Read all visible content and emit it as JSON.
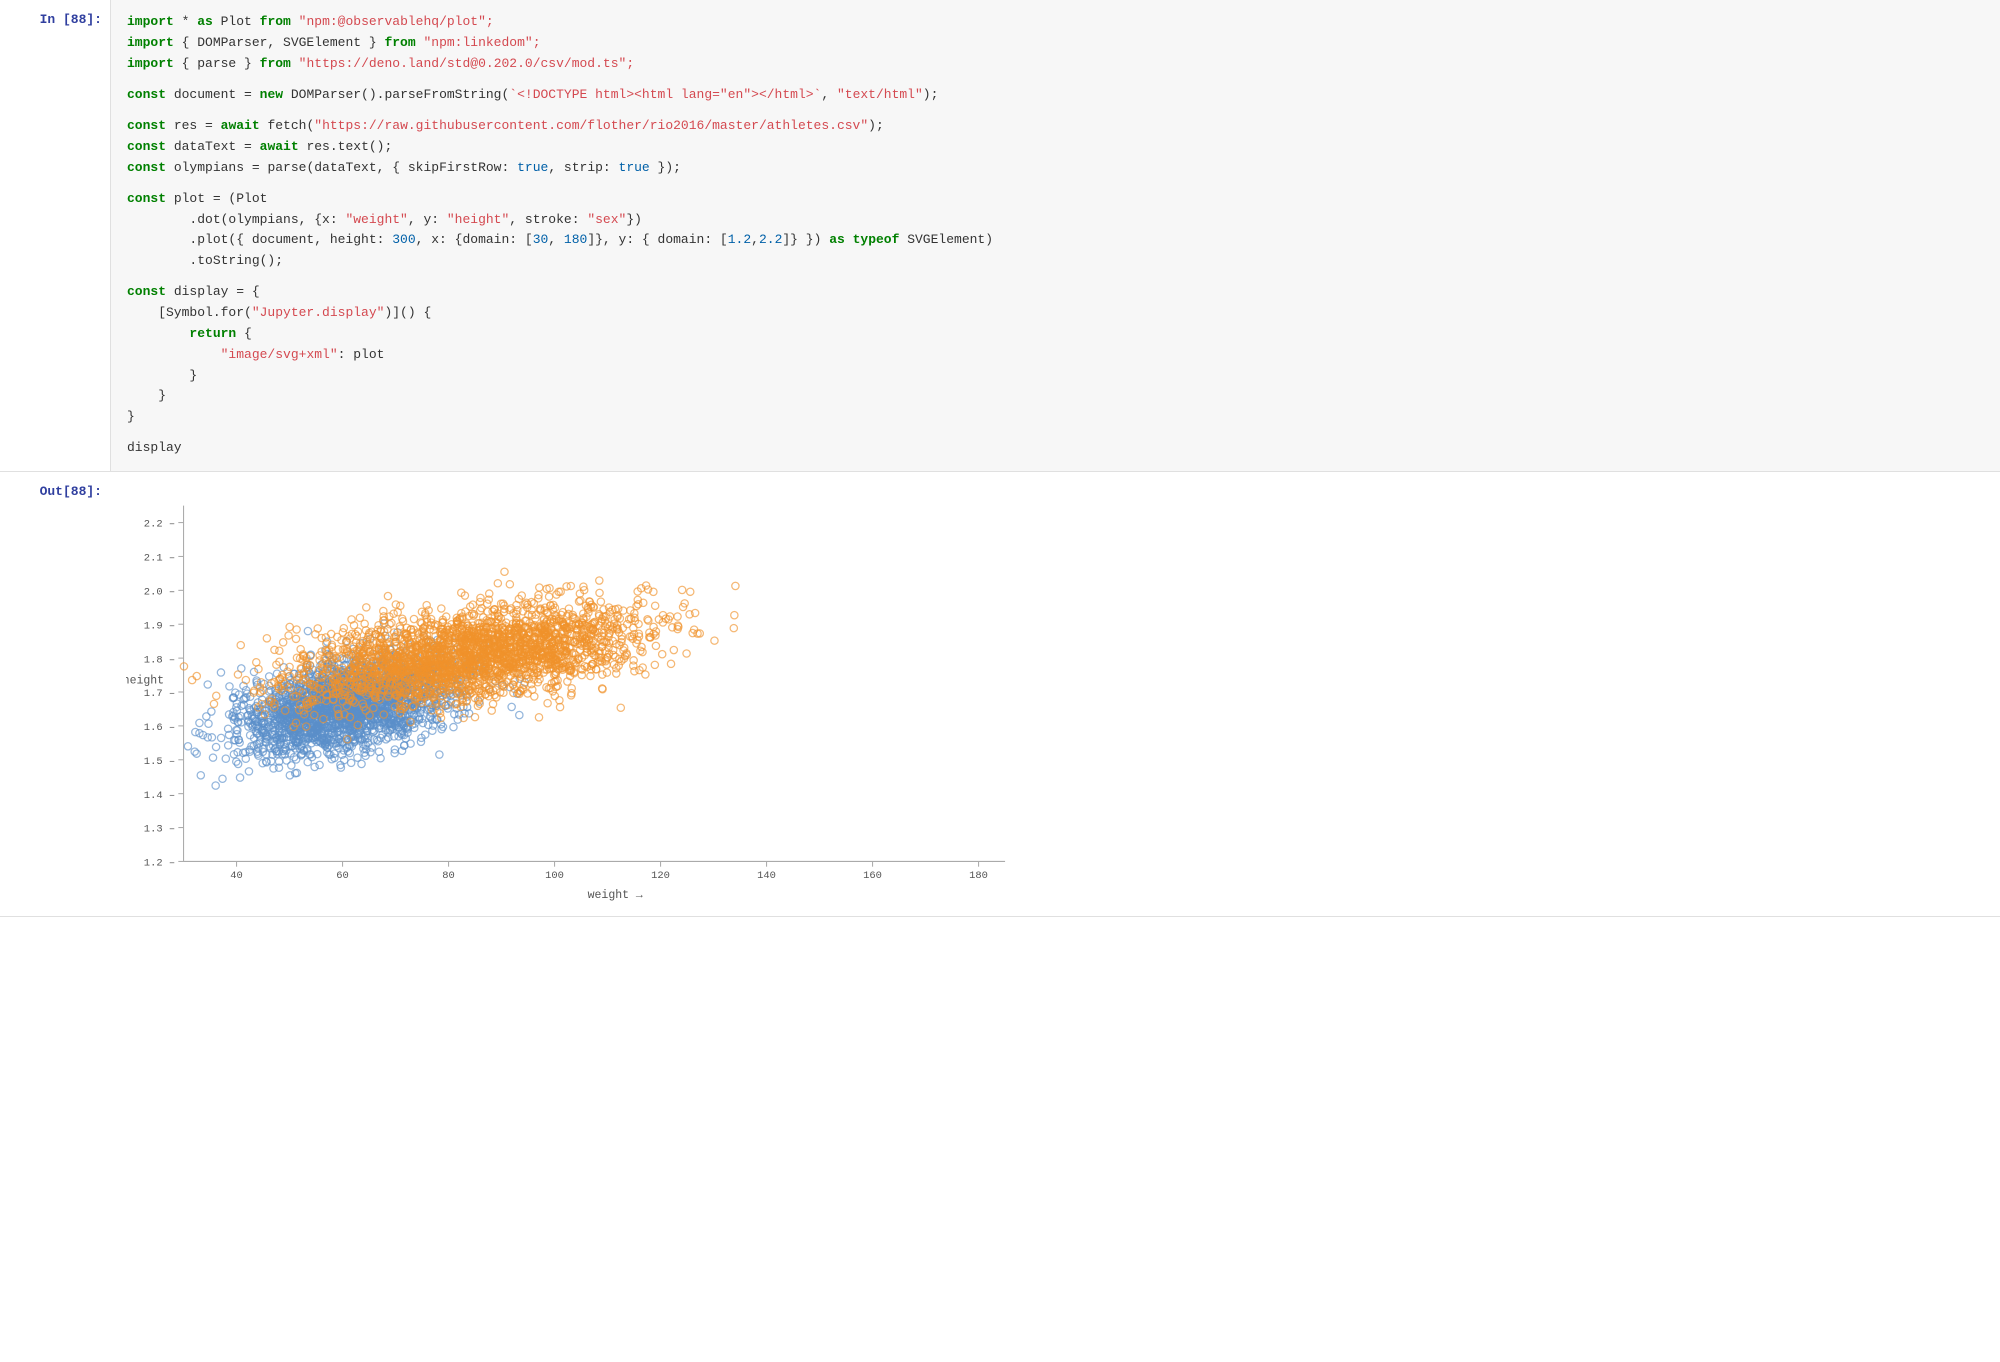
{
  "cell_in": {
    "label": "In [88]:",
    "lines": [
      {
        "parts": [
          {
            "text": "import",
            "cls": "kw"
          },
          {
            "text": " * ",
            "cls": "obj"
          },
          {
            "text": "as",
            "cls": "kw"
          },
          {
            "text": " Plot ",
            "cls": "obj"
          },
          {
            "text": "from",
            "cls": "kw"
          },
          {
            "text": " \"npm:@observablehq/plot\";",
            "cls": "str"
          }
        ]
      },
      {
        "parts": [
          {
            "text": "import",
            "cls": "kw"
          },
          {
            "text": " { DOMParser, SVGElement } ",
            "cls": "obj"
          },
          {
            "text": "from",
            "cls": "kw"
          },
          {
            "text": " \"npm:linkedom\";",
            "cls": "str"
          }
        ]
      },
      {
        "parts": [
          {
            "text": "import",
            "cls": "kw"
          },
          {
            "text": " { parse } ",
            "cls": "obj"
          },
          {
            "text": "from",
            "cls": "kw"
          },
          {
            "text": " \"https://deno.land/std@0.202.0/csv/mod.ts\";",
            "cls": "str"
          }
        ]
      },
      {
        "parts": [
          {
            "text": "",
            "cls": ""
          }
        ]
      },
      {
        "parts": [
          {
            "text": "const",
            "cls": "kw"
          },
          {
            "text": " document ",
            "cls": "obj"
          },
          {
            "text": "= ",
            "cls": "obj"
          },
          {
            "text": "new",
            "cls": "kw"
          },
          {
            "text": " DOMParser().parseFromString(",
            "cls": "obj"
          },
          {
            "text": "`<!DOCTYPE html><html lang=\"en\"></html>`",
            "cls": "str"
          },
          {
            "text": ", ",
            "cls": "obj"
          },
          {
            "text": "\"text/html\"",
            "cls": "str"
          },
          {
            "text": ");",
            "cls": "obj"
          }
        ]
      },
      {
        "parts": [
          {
            "text": "",
            "cls": ""
          }
        ]
      },
      {
        "parts": [
          {
            "text": "const",
            "cls": "kw"
          },
          {
            "text": " res ",
            "cls": "obj"
          },
          {
            "text": "= ",
            "cls": "obj"
          },
          {
            "text": "await",
            "cls": "kw"
          },
          {
            "text": " fetch(",
            "cls": "obj"
          },
          {
            "text": "\"https://raw.githubusercontent.com/flother/rio2016/master/athletes.csv\"",
            "cls": "str"
          },
          {
            "text": ");",
            "cls": "obj"
          }
        ]
      },
      {
        "parts": [
          {
            "text": "const",
            "cls": "kw"
          },
          {
            "text": " dataText ",
            "cls": "obj"
          },
          {
            "text": "= ",
            "cls": "obj"
          },
          {
            "text": "await",
            "cls": "kw"
          },
          {
            "text": " res.text();",
            "cls": "obj"
          }
        ]
      },
      {
        "parts": [
          {
            "text": "const",
            "cls": "kw"
          },
          {
            "text": " olympians ",
            "cls": "obj"
          },
          {
            "text": "= parse(dataText, { skipFirstRow: ",
            "cls": "obj"
          },
          {
            "text": "true",
            "cls": "bool"
          },
          {
            "text": ", strip: ",
            "cls": "obj"
          },
          {
            "text": "true",
            "cls": "bool"
          },
          {
            "text": " });",
            "cls": "obj"
          }
        ]
      },
      {
        "parts": [
          {
            "text": "",
            "cls": ""
          }
        ]
      },
      {
        "parts": [
          {
            "text": "const",
            "cls": "kw"
          },
          {
            "text": " plot = (Plot",
            "cls": "obj"
          }
        ]
      },
      {
        "parts": [
          {
            "text": "        .dot(olympians, {x: ",
            "cls": "obj"
          },
          {
            "text": "\"weight\"",
            "cls": "str"
          },
          {
            "text": ", y: ",
            "cls": "obj"
          },
          {
            "text": "\"height\"",
            "cls": "str"
          },
          {
            "text": ", stroke: ",
            "cls": "obj"
          },
          {
            "text": "\"sex\"",
            "cls": "str"
          },
          {
            "text": "})",
            "cls": "obj"
          }
        ]
      },
      {
        "parts": [
          {
            "text": "        .plot({ document, height: ",
            "cls": "obj"
          },
          {
            "text": "300",
            "cls": "num"
          },
          {
            "text": ", x: {domain: [",
            "cls": "obj"
          },
          {
            "text": "30",
            "cls": "num"
          },
          {
            "text": ", ",
            "cls": "obj"
          },
          {
            "text": "180",
            "cls": "num"
          },
          {
            "text": "]}, y: { domain: [",
            "cls": "obj"
          },
          {
            "text": "1.2",
            "cls": "num"
          },
          {
            "text": ",",
            "cls": "obj"
          },
          {
            "text": "2.2",
            "cls": "num"
          },
          {
            "text": "]} }) ",
            "cls": "obj"
          },
          {
            "text": "as typeof",
            "cls": "kw"
          },
          {
            "text": " SVGElement)",
            "cls": "obj"
          }
        ]
      },
      {
        "parts": [
          {
            "text": "        .toString();",
            "cls": "obj"
          }
        ]
      },
      {
        "parts": [
          {
            "text": "",
            "cls": ""
          }
        ]
      },
      {
        "parts": [
          {
            "text": "const",
            "cls": "kw"
          },
          {
            "text": " display = {",
            "cls": "obj"
          }
        ]
      },
      {
        "parts": [
          {
            "text": "    [Symbol.for(",
            "cls": "obj"
          },
          {
            "text": "\"Jupyter.display\"",
            "cls": "str"
          },
          {
            "text": ")]()",
            "cls": "obj"
          },
          {
            "text": " {",
            "cls": "obj"
          }
        ]
      },
      {
        "parts": [
          {
            "text": "        ",
            "cls": "obj"
          },
          {
            "text": "return",
            "cls": "kw"
          },
          {
            "text": " {",
            "cls": "obj"
          }
        ]
      },
      {
        "parts": [
          {
            "text": "            ",
            "cls": "obj"
          },
          {
            "text": "\"image/svg+xml\"",
            "cls": "str"
          },
          {
            "text": ": plot",
            "cls": "obj"
          }
        ]
      },
      {
        "parts": [
          {
            "text": "        }",
            "cls": "obj"
          }
        ]
      },
      {
        "parts": [
          {
            "text": "    }",
            "cls": "obj"
          }
        ]
      },
      {
        "parts": [
          {
            "text": "}",
            "cls": "obj"
          }
        ]
      },
      {
        "parts": [
          {
            "text": "",
            "cls": ""
          }
        ]
      },
      {
        "parts": [
          {
            "text": "display",
            "cls": "obj"
          }
        ]
      }
    ]
  },
  "cell_out": {
    "label": "Out[88]:",
    "chart": {
      "x_label": "weight →",
      "y_label": "↑ height",
      "x_ticks": [
        "40",
        "60",
        "80",
        "100",
        "120",
        "140",
        "160",
        "180"
      ],
      "y_ticks": [
        "1.2",
        "1.3",
        "1.4",
        "1.5",
        "1.6",
        "1.7",
        "1.8",
        "1.9",
        "2.0",
        "2.1",
        "2.2"
      ],
      "color_blue": "#5b8fc9",
      "color_orange": "#f0922b"
    }
  }
}
